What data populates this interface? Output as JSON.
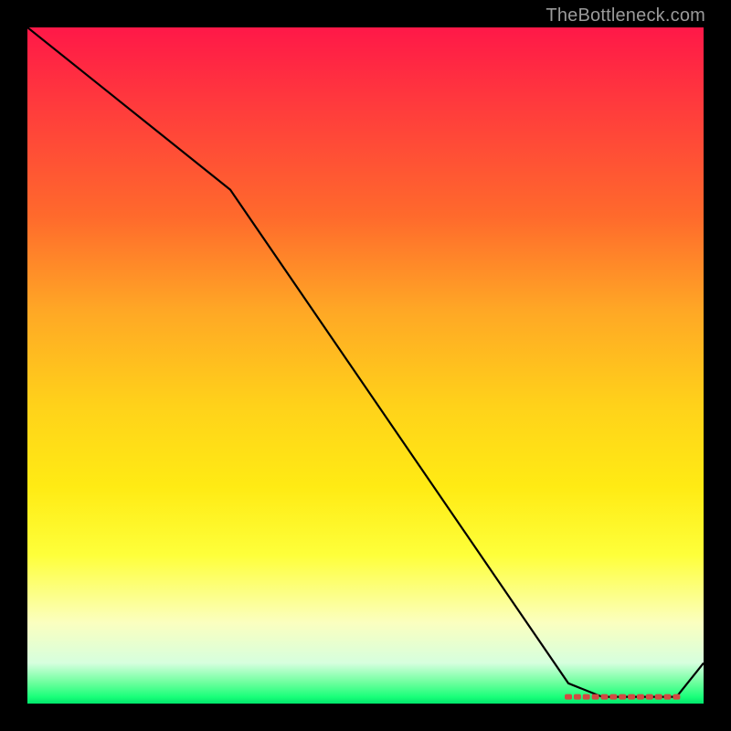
{
  "attribution": "TheBottleneck.com",
  "chart_data": {
    "type": "line",
    "title": "",
    "xlabel": "",
    "ylabel": "",
    "xlim": [
      0,
      100
    ],
    "ylim": [
      0,
      100
    ],
    "grid": false,
    "legend": false,
    "series": [
      {
        "name": "curve",
        "x": [
          0,
          30,
          80,
          85,
          90,
          96,
          100
        ],
        "values": [
          100,
          76,
          3,
          1,
          1,
          1,
          6
        ]
      }
    ],
    "marker_region": {
      "x_start": 80,
      "x_end": 96,
      "y": 1,
      "color": "#d24a42"
    },
    "colors": {
      "line": "#000000",
      "background_top": "#ff1848",
      "background_bottom": "#00e66b"
    }
  }
}
